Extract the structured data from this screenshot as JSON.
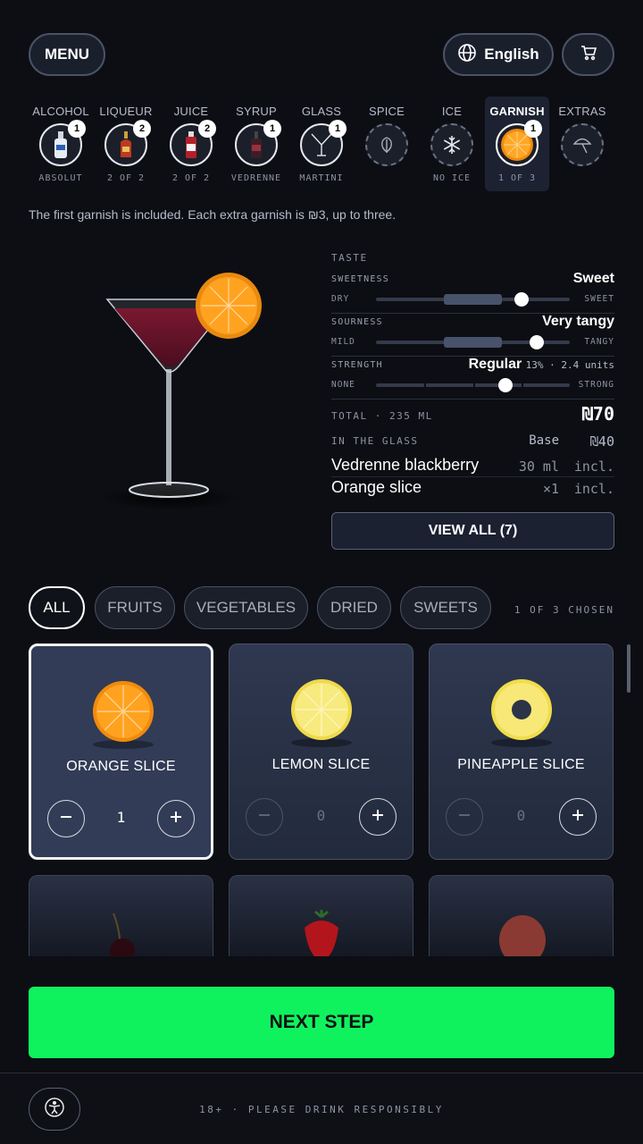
{
  "header": {
    "menu_label": "MENU",
    "language_label": "English",
    "cart_icon": "cart-icon"
  },
  "steps": [
    {
      "label": "ALCOHOL",
      "badge": "1",
      "sub": "ABSOLUT"
    },
    {
      "label": "LIQUEUR",
      "badge": "2",
      "sub": "2 OF 2"
    },
    {
      "label": "JUICE",
      "badge": "2",
      "sub": "2 OF 2"
    },
    {
      "label": "SYRUP",
      "badge": "1",
      "sub": "VEDRENNE"
    },
    {
      "label": "GLASS",
      "badge": "1",
      "sub": "MARTINI"
    },
    {
      "label": "SPICE",
      "badge": "",
      "sub": ""
    },
    {
      "label": "ICE",
      "badge": "",
      "sub": "NO ICE"
    },
    {
      "label": "GARNISH",
      "badge": "1",
      "sub": "1 OF 3",
      "active": true
    },
    {
      "label": "EXTRAS",
      "badge": "",
      "sub": ""
    }
  ],
  "info_text": "The first garnish is included. Each extra garnish is ₪3, up to three.",
  "taste": {
    "title": "TASTE",
    "rows": [
      {
        "name": "SWEETNESS",
        "value": "Sweet",
        "min": "DRY",
        "max": "SWEET",
        "level": 0.75
      },
      {
        "name": "SOURNESS",
        "value": "Very tangy",
        "min": "MILD",
        "max": "TANGY",
        "level": 0.83
      },
      {
        "name": "STRENGTH",
        "value": "Regular",
        "value_extra": "13% · 2.4 units",
        "min": "NONE",
        "max": "STRONG",
        "level": 0.67
      }
    ]
  },
  "summary": {
    "total_label": "TOTAL · 235 ML",
    "total_price": "₪70",
    "in_glass_label": "IN THE GLASS",
    "base_label": "Base",
    "base_price": "₪40",
    "items": [
      {
        "name": "Vedrenne blackberry",
        "amount": "30 ml",
        "price": "incl."
      },
      {
        "name": "Orange slice",
        "amount": "×1",
        "price": "incl."
      }
    ],
    "view_all_label": "VIEW ALL (7)"
  },
  "filters": {
    "chips": [
      "ALL",
      "FRUITS",
      "VEGETABLES",
      "DRIED",
      "SWEETS"
    ],
    "chosen_text": "1 OF 3 CHOSEN"
  },
  "garnishes": [
    {
      "name": "ORANGE SLICE",
      "qty": "1",
      "selected": true
    },
    {
      "name": "LEMON SLICE",
      "qty": "0"
    },
    {
      "name": "PINEAPPLE SLICE",
      "qty": "0"
    }
  ],
  "next_label": "NEXT STEP",
  "footer": {
    "text": "18+ · PLEASE DRINK RESPONSIBLY"
  },
  "colors": {
    "accent": "#0ff25e",
    "background": "#0c0e13",
    "card": "#2f3850"
  }
}
